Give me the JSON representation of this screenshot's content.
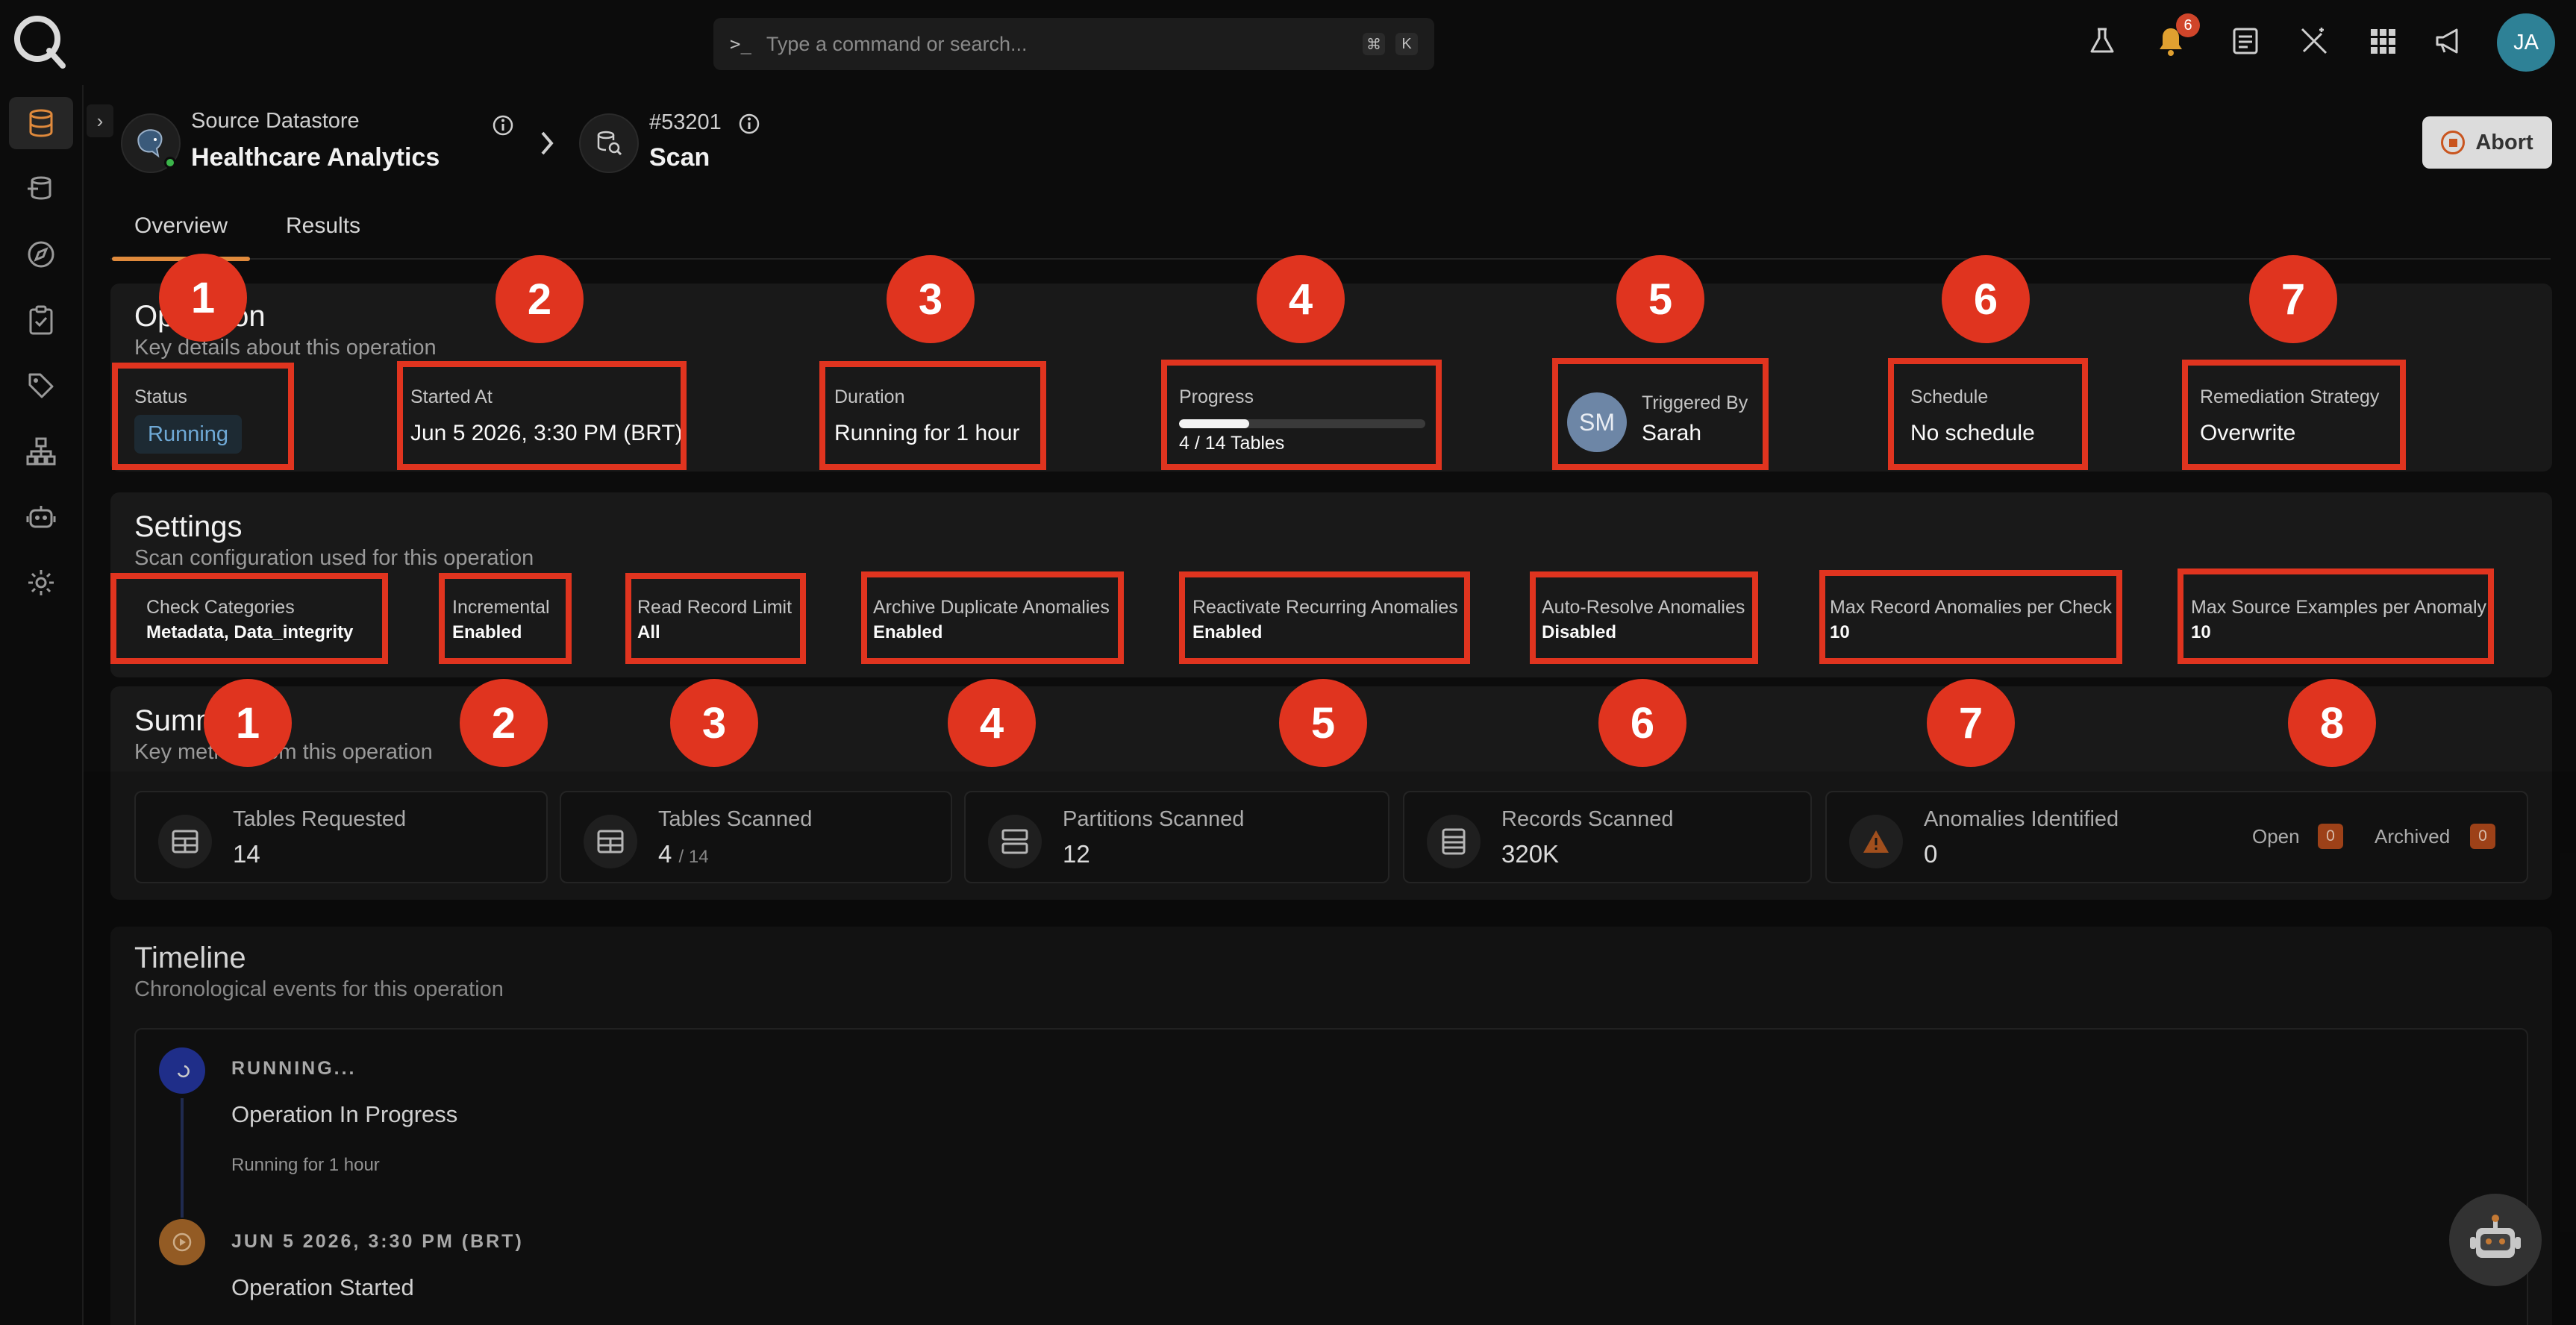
{
  "topbar": {
    "command_placeholder": "Type a command or search...",
    "shortcut_key1": "⌘",
    "shortcut_key2": "K",
    "notification_count": "6",
    "user_initials": "JA"
  },
  "breadcrumb": {
    "datastore_label": "Source Datastore",
    "datastore_name": "Healthcare Analytics",
    "operation_id": "#53201",
    "operation_type": "Scan"
  },
  "actions": {
    "abort_label": "Abort"
  },
  "tabs": [
    {
      "label": "Overview"
    },
    {
      "label": "Results"
    }
  ],
  "operation": {
    "title": "Operation",
    "subtitle": "Key details about this operation",
    "status": {
      "label": "Status",
      "value": "Running"
    },
    "started_at": {
      "label": "Started At",
      "value": "Jun 5 2026, 3:30 PM (BRT)"
    },
    "duration": {
      "label": "Duration",
      "value": "Running for 1 hour"
    },
    "progress": {
      "label": "Progress",
      "value": "4 / 14 Tables",
      "fraction": 0.2857
    },
    "triggered_by": {
      "label": "Triggered By",
      "value": "Sarah",
      "initials": "SM"
    },
    "schedule": {
      "label": "Schedule",
      "value": "No schedule"
    },
    "remediation": {
      "label": "Remediation Strategy",
      "value": "Overwrite"
    }
  },
  "settings": {
    "title": "Settings",
    "subtitle": "Scan configuration used for this operation",
    "items": [
      {
        "label": "Check Categories",
        "value": "Metadata, Data_integrity"
      },
      {
        "label": "Incremental",
        "value": "Enabled"
      },
      {
        "label": "Read Record Limit",
        "value": "All"
      },
      {
        "label": "Archive Duplicate Anomalies",
        "value": "Enabled"
      },
      {
        "label": "Reactivate Recurring Anomalies",
        "value": "Enabled"
      },
      {
        "label": "Auto-Resolve Anomalies",
        "value": "Disabled"
      },
      {
        "label": "Max Record Anomalies per Check",
        "value": "10"
      },
      {
        "label": "Max Source Examples per Anomaly",
        "value": "10"
      }
    ]
  },
  "summary": {
    "title": "Summary",
    "subtitle": "Key metrics from this operation",
    "cards": [
      {
        "label": "Tables Requested",
        "value": "14",
        "icon": "table-icon"
      },
      {
        "label": "Tables Scanned",
        "value": "4",
        "suffix": "/ 14",
        "icon": "table-icon"
      },
      {
        "label": "Partitions Scanned",
        "value": "12",
        "icon": "partition-icon"
      },
      {
        "label": "Records Scanned",
        "value": "320K",
        "icon": "records-icon"
      },
      {
        "label": "Anomalies Identified",
        "value": "0",
        "icon": "warning-icon"
      }
    ],
    "open_label": "Open",
    "open_count": "0",
    "archived_label": "Archived",
    "archived_count": "0"
  },
  "timeline": {
    "title": "Timeline",
    "subtitle": "Chronological events for this operation",
    "events": [
      {
        "tag": "RUNNING...",
        "title": "Operation In Progress",
        "detail": "Running for 1 hour"
      },
      {
        "tag": "JUN 5 2026, 3:30 PM (BRT)",
        "title": "Operation Started"
      }
    ]
  },
  "markers": {
    "operation": [
      "1",
      "2",
      "3",
      "4",
      "5",
      "6",
      "7"
    ],
    "settings": [
      "1",
      "2",
      "3",
      "4",
      "5",
      "6",
      "7",
      "8"
    ]
  },
  "colors": {
    "accent": "#e08a3c",
    "annotation_red": "#e0341f",
    "running_blue": "#6fa9d6",
    "background": "#0c0c0c",
    "panel": "#191919"
  }
}
